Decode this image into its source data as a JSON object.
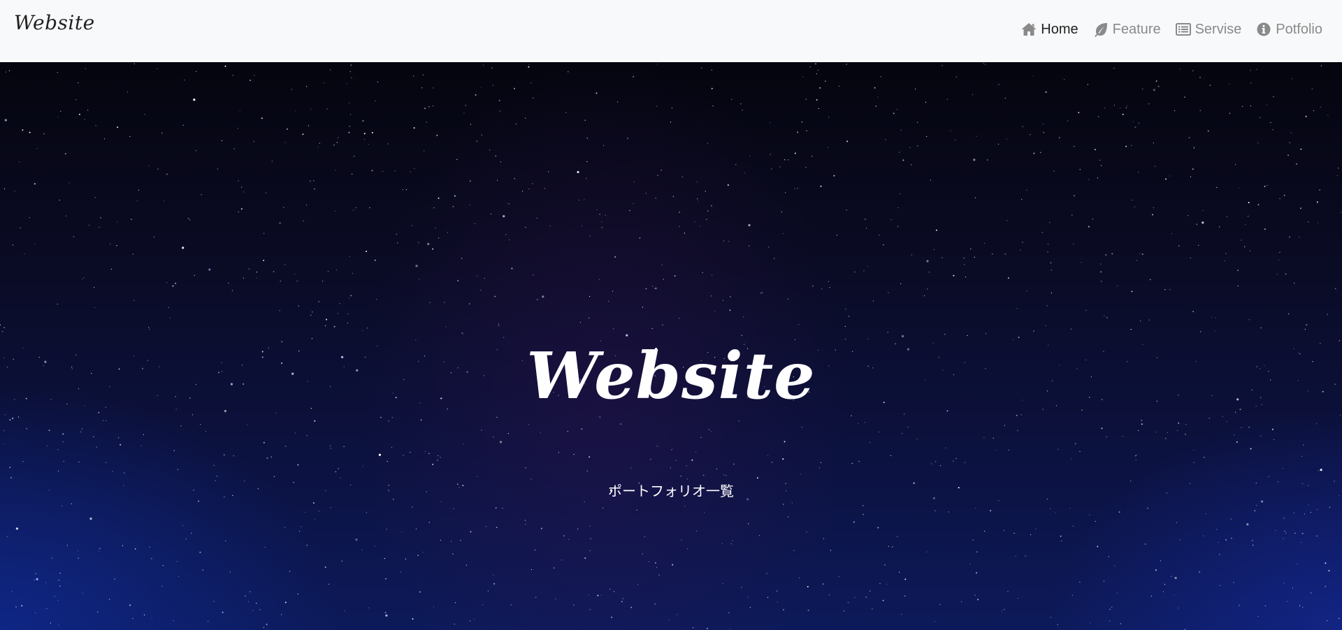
{
  "navbar": {
    "brand": "Website",
    "items": [
      {
        "label": "Home",
        "icon": "home-icon",
        "active": true
      },
      {
        "label": "Feature",
        "icon": "leaf-icon",
        "active": false
      },
      {
        "label": "Servise",
        "icon": "list-icon",
        "active": false
      },
      {
        "label": "Potfolio",
        "icon": "info-circle-icon",
        "active": false
      }
    ]
  },
  "hero": {
    "title": "Website",
    "subtitle": "ポートフォリオ一覧"
  },
  "colors": {
    "navbar_bg": "#f8f9fa",
    "nav_active": "#222222",
    "nav_inactive": "#8a8a8a",
    "hero_text": "#ffffff"
  }
}
